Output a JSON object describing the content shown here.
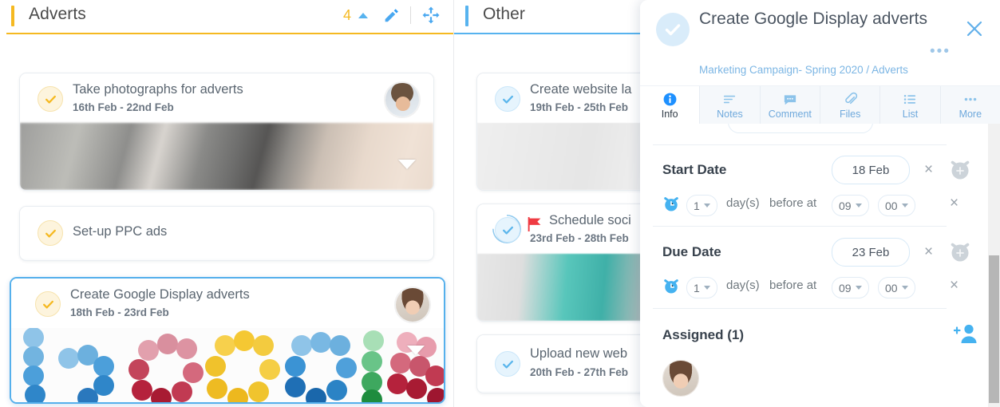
{
  "columns": [
    {
      "id": "adverts",
      "title": "Adverts",
      "accent_color": "#f5b921",
      "count": "4",
      "tools": [
        "collapse-chevron",
        "edit-pencil",
        "move-handle"
      ],
      "cards": [
        {
          "title": "Take photographs for adverts",
          "dates": "16th Feb - 22nd Feb",
          "check_style": "yellow",
          "has_avatar": true,
          "avatar": "male",
          "thumbnail": "camera-photo",
          "expand": true,
          "flag": false,
          "selected": false
        },
        {
          "title": "Set-up PPC ads",
          "dates": "",
          "check_style": "yellow",
          "has_avatar": false,
          "avatar": "",
          "thumbnail": "",
          "expand": false,
          "flag": false,
          "selected": false
        },
        {
          "title": "Create Google Display adverts",
          "dates": "18th Feb - 23rd Feb",
          "check_style": "yellow",
          "has_avatar": true,
          "avatar": "female",
          "thumbnail": "google-balls",
          "expand": true,
          "flag": false,
          "selected": true
        }
      ]
    },
    {
      "id": "other",
      "title": "Other",
      "accent_color": "#57b3ef",
      "count": "",
      "tools": [],
      "cards": [
        {
          "title": "Create website la",
          "dates": "19th Feb - 25th Feb",
          "check_style": "blue",
          "has_avatar": false,
          "avatar": "",
          "thumbnail": "laptop-photo",
          "expand": false,
          "flag": false,
          "selected": false
        },
        {
          "title": "Schedule soci",
          "dates": "23rd Feb - 28th Feb",
          "check_style": "blue-ring",
          "has_avatar": false,
          "avatar": "",
          "thumbnail": "phone-apps-photo",
          "expand": false,
          "flag": true,
          "selected": false
        },
        {
          "title": "Upload new web",
          "dates": "20th Feb - 27th Feb",
          "check_style": "blue",
          "has_avatar": false,
          "avatar": "",
          "thumbnail": "",
          "expand": false,
          "flag": false,
          "selected": false
        }
      ]
    }
  ],
  "panel": {
    "title": "Create Google Display adverts",
    "breadcrumb": "Marketing Campaign- Spring 2020 / Adverts",
    "close_label": "×",
    "more_dots": "•••",
    "tabs": [
      {
        "label": "Info",
        "icon": "info-icon",
        "active": true
      },
      {
        "label": "Notes",
        "icon": "notes-icon",
        "active": false
      },
      {
        "label": "Comment",
        "icon": "comment-icon",
        "active": false
      },
      {
        "label": "Files",
        "icon": "paperclip-icon",
        "active": false
      },
      {
        "label": "List",
        "icon": "list-icon",
        "active": false
      },
      {
        "label": "More",
        "icon": "ellipsis-icon",
        "active": false
      }
    ],
    "start_date": {
      "label": "Start Date",
      "value": "18 Feb",
      "clear": "×",
      "reminder": {
        "amount": "1",
        "text_before": "day(s)",
        "text_middle": "before at",
        "hour": "09",
        "minute": "00",
        "remove": "×"
      }
    },
    "due_date": {
      "label": "Due Date",
      "value": "23 Feb",
      "clear": "×",
      "reminder": {
        "amount": "1",
        "text_before": "day(s)",
        "text_middle": "before at",
        "hour": "09",
        "minute": "00",
        "remove": "×"
      }
    },
    "assigned": {
      "label": "Assigned (1)",
      "avatars": [
        "female"
      ]
    }
  },
  "colors": {
    "accent_blue": "#2f9cf4",
    "accent_yellow": "#f5b921",
    "flag_red": "#ef3b42",
    "text_dark": "#38424d",
    "text_muted": "#6b7682"
  }
}
